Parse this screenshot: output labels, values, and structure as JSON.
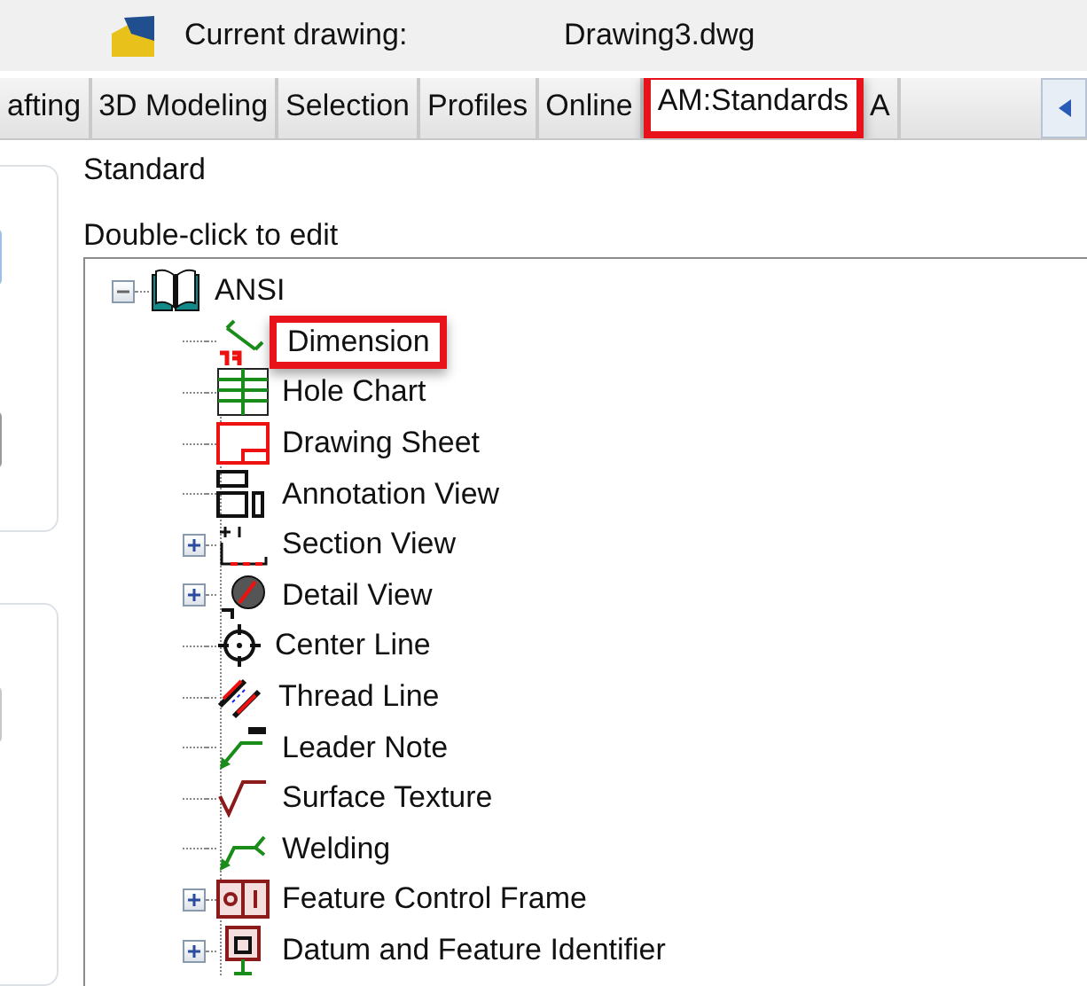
{
  "header": {
    "label": "Current drawing:",
    "value": "Drawing3.dwg"
  },
  "tabs": [
    {
      "label": "afting",
      "selected": false,
      "highlighted": false
    },
    {
      "label": "3D Modeling",
      "selected": false,
      "highlighted": false
    },
    {
      "label": "Selection",
      "selected": false,
      "highlighted": false
    },
    {
      "label": "Profiles",
      "selected": false,
      "highlighted": false
    },
    {
      "label": "Online",
      "selected": false,
      "highlighted": false
    },
    {
      "label": "AM:Standards",
      "selected": true,
      "highlighted": true
    },
    {
      "label": "A",
      "selected": false,
      "highlighted": false
    }
  ],
  "standard_label": "Standard",
  "tree_label": "Double-click to edit",
  "tree": [
    {
      "label": "ANSI",
      "expanded": true,
      "highlighted": false,
      "children": [
        {
          "label": "Dimension",
          "expandable": false,
          "highlighted": true
        },
        {
          "label": "Hole Chart",
          "expandable": false,
          "highlighted": false
        },
        {
          "label": "Drawing Sheet",
          "expandable": false,
          "highlighted": false
        },
        {
          "label": "Annotation View",
          "expandable": false,
          "highlighted": false
        },
        {
          "label": "Section View",
          "expandable": true,
          "highlighted": false
        },
        {
          "label": "Detail View",
          "expandable": true,
          "highlighted": false
        },
        {
          "label": "Center Line",
          "expandable": false,
          "highlighted": false
        },
        {
          "label": "Thread Line",
          "expandable": false,
          "highlighted": false
        },
        {
          "label": "Leader Note",
          "expandable": false,
          "highlighted": false
        },
        {
          "label": "Surface Texture",
          "expandable": false,
          "highlighted": false
        },
        {
          "label": "Welding",
          "expandable": false,
          "highlighted": false
        },
        {
          "label": "Feature Control Frame",
          "expandable": true,
          "highlighted": false
        },
        {
          "label": "Datum and Feature Identifier",
          "expandable": true,
          "highlighted": false
        }
      ]
    }
  ]
}
